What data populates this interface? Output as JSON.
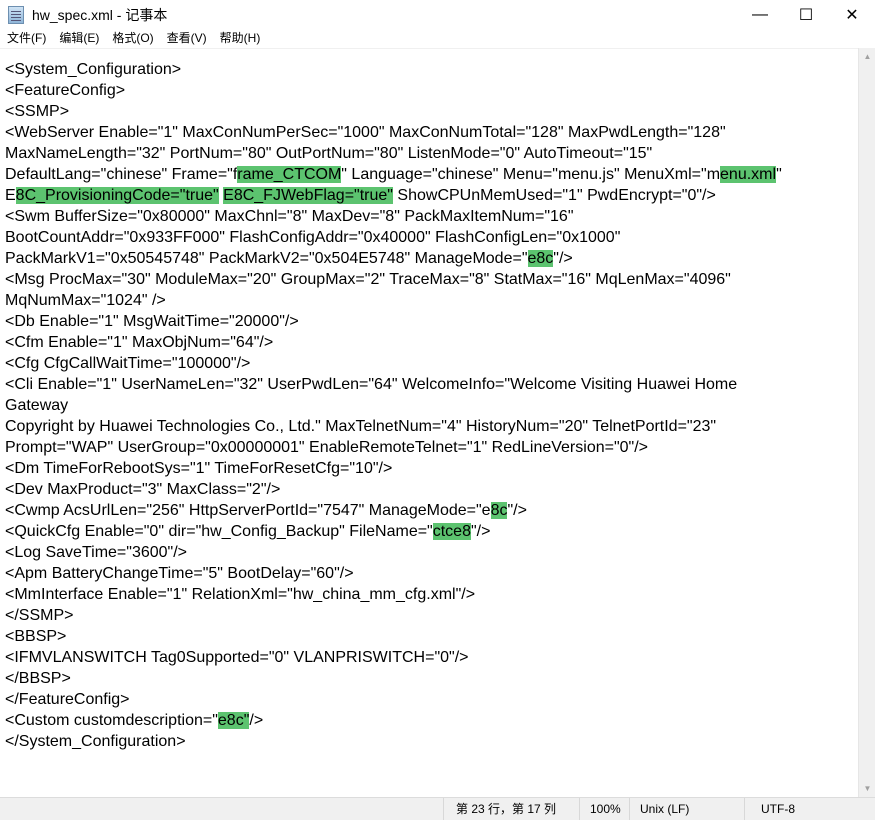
{
  "window": {
    "title": "hw_spec.xml - 记事本",
    "icon": "notepad-icon",
    "minimize": "—",
    "maximize": "☐",
    "close": "✕"
  },
  "menu": [
    "文件(F)",
    "编辑(E)",
    "格式(O)",
    "查看(V)",
    "帮助(H)"
  ],
  "highlight_color": "#5cc36f",
  "lines": [
    [
      {
        "t": "<System_Configuration>"
      }
    ],
    [
      {
        "t": "<FeatureConfig>"
      }
    ],
    [
      {
        "t": "<SSMP>"
      }
    ],
    [
      {
        "t": "<WebServer Enable=\"1\" MaxConNumPerSec=\"1000\" MaxConNumTotal=\"128\" MaxPwdLength=\"128\""
      }
    ],
    [
      {
        "t": "MaxNameLength=\"32\" PortNum=\"80\" OutPortNum=\"80\" ListenMode=\"0\" AutoTimeout=\"15\""
      }
    ],
    [
      {
        "t": "DefaultLang=\"chinese\" Frame=\"f"
      },
      {
        "t": "rame_CTCOM",
        "hl": true
      },
      {
        "t": "\" Language=\"chinese\" Menu=\"menu.js\" MenuXml=\"m"
      },
      {
        "t": "enu.xml",
        "hl": true
      },
      {
        "t": "\""
      }
    ],
    [
      {
        "t": "E"
      },
      {
        "t": "8C_ProvisioningCode=\"true\"",
        "hl": true
      },
      {
        "t": " "
      },
      {
        "t": "E8C_FJWebFlag=\"true\"",
        "hl": true
      },
      {
        "t": " ShowCPUnMemUsed=\"1\" PwdEncrypt=\"0\"/>"
      }
    ],
    [
      {
        "t": "<Swm BufferSize=\"0x80000\" MaxChnl=\"8\" MaxDev=\"8\" PackMaxItemNum=\"16\""
      }
    ],
    [
      {
        "t": "BootCountAddr=\"0x933FF000\" FlashConfigAddr=\"0x40000\" FlashConfigLen=\"0x1000\""
      }
    ],
    [
      {
        "t": "PackMarkV1=\"0x50545748\" PackMarkV2=\"0x504E5748\" ManageMode=\""
      },
      {
        "t": "e8c",
        "hl": true
      },
      {
        "t": "\"/>"
      }
    ],
    [
      {
        "t": "<Msg ProcMax=\"30\" ModuleMax=\"20\" GroupMax=\"2\" TraceMax=\"8\" StatMax=\"16\" MqLenMax=\"4096\""
      }
    ],
    [
      {
        "t": "MqNumMax=\"1024\" />"
      }
    ],
    [
      {
        "t": "<Db Enable=\"1\" MsgWaitTime=\"20000\"/>"
      }
    ],
    [
      {
        "t": "<Cfm Enable=\"1\" MaxObjNum=\"64\"/>"
      }
    ],
    [
      {
        "t": "<Cfg CfgCallWaitTime=\"100000\"/>"
      }
    ],
    [
      {
        "t": "<Cli Enable=\"1\" UserNameLen=\"32\" UserPwdLen=\"64\" WelcomeInfo=\"Welcome Visiting Huawei Home"
      }
    ],
    [
      {
        "t": "Gateway"
      }
    ],
    [
      {
        "t": "Copyright by Huawei Technologies Co., Ltd.\" MaxTelnetNum=\"4\" HistoryNum=\"20\" TelnetPortId=\"23\""
      }
    ],
    [
      {
        "t": "Prompt=\"WAP\" UserGroup=\"0x00000001\" EnableRemoteTelnet=\"1\" RedLineVersion=\"0\"/>"
      }
    ],
    [
      {
        "t": "<Dm TimeForRebootSys=\"1\" TimeForResetCfg=\"10\"/>"
      }
    ],
    [
      {
        "t": "<Dev MaxProduct=\"3\" MaxClass=\"2\"/>"
      }
    ],
    [
      {
        "t": "<Cwmp AcsUrlLen=\"256\" HttpServerPortId=\"7547\" ManageMode=\"e"
      },
      {
        "t": "8c",
        "hl": true
      },
      {
        "t": "\"/>"
      }
    ],
    [
      {
        "t": "<QuickCfg Enable=\"0\" dir=\"hw_Config_Backup\" FileName=\""
      },
      {
        "t": "ctce8",
        "hl": true
      },
      {
        "t": "\"/>"
      }
    ],
    [
      {
        "t": "<Log SaveTime=\"3600\"/>"
      }
    ],
    [
      {
        "t": "<Apm BatteryChangeTime=\"5\" BootDelay=\"60\"/>"
      }
    ],
    [
      {
        "t": "<MmInterface Enable=\"1\" RelationXml=\"hw_china_mm_cfg.xml\"/>"
      }
    ],
    [
      {
        "t": "</SSMP>"
      }
    ],
    [
      {
        "t": "<BBSP>"
      }
    ],
    [
      {
        "t": "<IFMVLANSWITCH Tag0Supported=\"0\" VLANPRISWITCH=\"0\"/>"
      }
    ],
    [
      {
        "t": "</BBSP>"
      }
    ],
    [
      {
        "t": "</FeatureConfig>"
      }
    ],
    [
      {
        "t": "<Custom customdescription=\""
      },
      {
        "t": "e8c\"",
        "hl": true
      },
      {
        "t": "/>"
      }
    ],
    [
      {
        "t": "</System_Configuration>"
      }
    ]
  ],
  "status": {
    "position": "第 23 行，第 17 列",
    "zoom": "100%",
    "line_ending": "Unix (LF)",
    "encoding": "UTF-8"
  }
}
